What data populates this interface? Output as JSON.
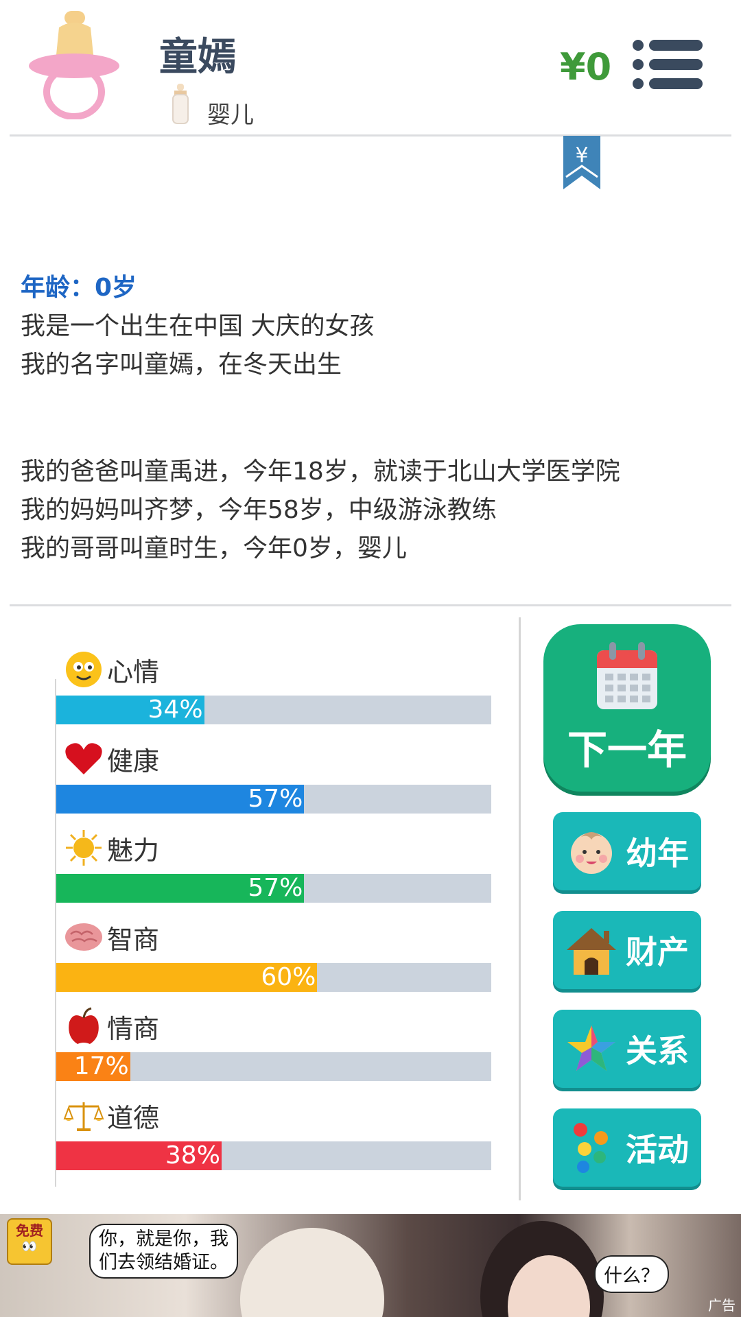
{
  "header": {
    "name": "童嫣",
    "stage": "婴儿",
    "money": "¥0",
    "avatar_icon": "pacifier-icon",
    "stage_icon": "baby-bottle-icon",
    "menu_icon": "menu-list-icon",
    "bookmark_icon": "yuan-bookmark-icon",
    "bookmark_symbol": "¥"
  },
  "story": {
    "age_line": "年龄：0岁",
    "lines_a": [
      "我是一个出生在中国 大庆的女孩",
      "我的名字叫童嫣，在冬天出生"
    ],
    "lines_b": [
      "我的爸爸叫童禹进，今年18岁，就读于北山大学医学院",
      "我的妈妈叫齐梦，今年58岁，中级游泳教练",
      "我的哥哥叫童时生，今年0岁，婴儿"
    ]
  },
  "stats": [
    {
      "label": "心情",
      "value": 34,
      "display": "34%",
      "color": "#1bb3dc",
      "icon": "smiley-icon"
    },
    {
      "label": "健康",
      "value": 57,
      "display": "57%",
      "color": "#1e86e0",
      "icon": "heart-icon"
    },
    {
      "label": "魅力",
      "value": 57,
      "display": "57%",
      "color": "#17b65a",
      "icon": "sun-icon"
    },
    {
      "label": "智商",
      "value": 60,
      "display": "60%",
      "color": "#fbb312",
      "icon": "brain-icon"
    },
    {
      "label": "情商",
      "value": 17,
      "display": "17%",
      "color": "#fa8215",
      "icon": "apple-icon"
    },
    {
      "label": "道德",
      "value": 38,
      "display": "38%",
      "color": "#ef3344",
      "icon": "scales-icon"
    }
  ],
  "actions": {
    "next_year": "下一年",
    "next_year_icon": "calendar-icon",
    "buttons": [
      {
        "label": "幼年",
        "icon": "baby-face-icon"
      },
      {
        "label": "财产",
        "icon": "house-icon"
      },
      {
        "label": "关系",
        "icon": "star-icon"
      },
      {
        "label": "活动",
        "icon": "dots-icon"
      }
    ]
  },
  "ad": {
    "badge": "免费",
    "bubble1": "你，就是你，我\n们去领结婚证。",
    "bubble2": "什么？",
    "tag": "广告"
  }
}
